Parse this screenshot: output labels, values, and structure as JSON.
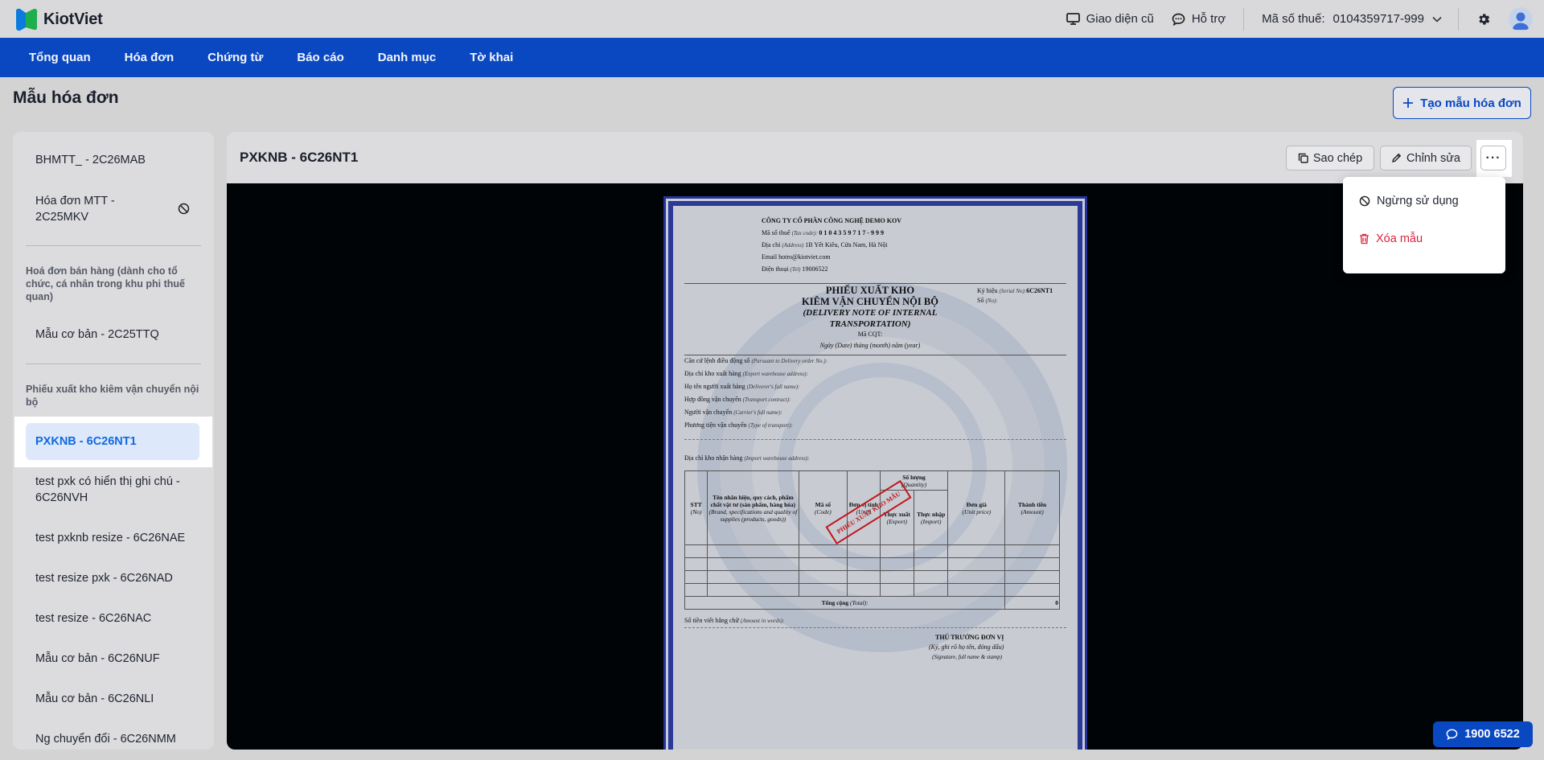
{
  "app": {
    "name": "KiotViet"
  },
  "topbar": {
    "old_ui_label": "Giao diện cũ",
    "support_label": "Hỗ trợ",
    "tax_label": "Mã số thuế:",
    "tax_value": "0104359717-999"
  },
  "nav": [
    "Tổng quan",
    "Hóa đơn",
    "Chứng từ",
    "Báo cáo",
    "Danh mục",
    "Tờ khai"
  ],
  "page": {
    "title": "Mẫu hóa đơn",
    "create_button": "Tạo mẫu hóa đơn"
  },
  "sidebar": {
    "item_bhmtt": "BHMTT_ - 2C26MAB",
    "item_mtt_line1": "Hóa đơn MTT -",
    "item_mtt_line2": "2C25MKV",
    "group_sales": "Hoá đơn bán hàng (dành cho tổ chức, cá nhân trong khu phi thuế quan)",
    "item_basic_2c25": "Mẫu cơ bản - 2C25TTQ",
    "group_pxk": "Phiếu xuất kho kiêm vận chuyển nội bộ",
    "active_item": "PXKNB - 6C26NT1",
    "item_note_line1": "test pxk có hiển thị ghi chú -",
    "item_note_line2": "6C26NVH",
    "item_nae": "test pxknb resize - 6C26NAE",
    "item_nad": "test resize pxk - 6C26NAD",
    "item_nac": "test resize - 6C26NAC",
    "item_nuf": "Mẫu cơ bản - 6C26NUF",
    "item_nli": "Mẫu cơ bản - 6C26NLI",
    "item_partial": "Ng chuyển đổi - 6C26NMM"
  },
  "main": {
    "title": "PXKNB - 6C26NT1",
    "copy_button": "Sao chép",
    "edit_button": "Chỉnh sửa",
    "more_button": "···"
  },
  "dropdown": {
    "stop_use": "Ngừng sử dụng",
    "delete": "Xóa mẫu"
  },
  "document": {
    "company": "CÔNG TY CỔ PHẦN CÔNG NGHỆ DEMO KOV",
    "tax_line_label": "Mã số thuế",
    "tax_line_en": "(Tax code):",
    "tax_line_value": "0 1 0 4 3 5 9 7 1 7 - 9 9 9",
    "addr_label": "Địa chỉ",
    "addr_en": "(Address)",
    "addr_value": "1B Yết Kiêu, Cửa Nam, Hà Nội",
    "email": "Email hotro@kiotviet.com",
    "phone_label": "Điện thoại",
    "phone_en": "(Tel)",
    "phone_value": "19006522",
    "title1": "PHIẾU XUẤT KHO",
    "title2": "KIÊM VẬN CHUYỂN NỘI BỘ",
    "title_en": "(DELIVERY NOTE OF INTERNAL TRANSPORTATION)",
    "mcqt": "Mã CQT:",
    "date_line": "Ngày (Date) tháng (month) năm (year)",
    "serial_label": "Ký hiệu",
    "serial_en": "(Serial No):",
    "serial_value": "6C26NT1",
    "no_label": "Số",
    "no_en": "(No):",
    "fields": [
      {
        "vi": "Căn cứ lệnh điều động số",
        "en": "(Pursuant to Delivery order No.):"
      },
      {
        "vi": "Địa chỉ kho xuất hàng",
        "en": "(Export warehouse address):"
      },
      {
        "vi": "Họ tên người xuất hàng",
        "en": "(Deliverer's full name):"
      },
      {
        "vi": "Hợp đồng vận chuyển",
        "en": "(Transport contract):"
      },
      {
        "vi": "Người vận chuyển",
        "en": "(Carrier's full name):"
      },
      {
        "vi": "Phương tiện vận chuyển",
        "en": "(Type of transport):"
      }
    ],
    "import_addr": "Địa chỉ kho nhận hàng",
    "import_addr_en": "(Import warehouse address):",
    "col_stt": "STT",
    "col_stt_en": "(No)",
    "col_name": "Tên nhãn hiệu, quy cách, phẩm chất vật tư (sản phẩm, hàng hóa)",
    "col_name_en": "(Brand, specifications and quality of supplies (products, goods))",
    "col_code": "Mã số",
    "col_code_en": "(Code)",
    "col_unit": "Đơn vị tính",
    "col_unit_en": "(Unit)",
    "col_qty": "Số lượng",
    "col_qty_en": "(Quantity)",
    "col_export": "Thực xuất",
    "col_export_en": "(Export)",
    "col_import": "Thực nhập",
    "col_import_en": "(Import)",
    "col_price": "Đơn giá",
    "col_price_en": "(Unit price)",
    "col_amount": "Thành tiền",
    "col_amount_en": "(Amount)",
    "total_label": "Tổng cộng",
    "total_en": "(Total):",
    "total_value": "0",
    "words_label": "Số tiền viết bằng chữ",
    "words_en": "(Amount in words):",
    "sign_title": "THỦ TRƯỞNG ĐƠN VỊ",
    "sign_sub": "(Ký, ghi rõ họ tên, đóng dấu)",
    "sign_sub_en": "(Signature, full name & stamp)",
    "stamp": "PHIẾU XUẤT KHO MẪU"
  },
  "support_phone": "1900 6522"
}
